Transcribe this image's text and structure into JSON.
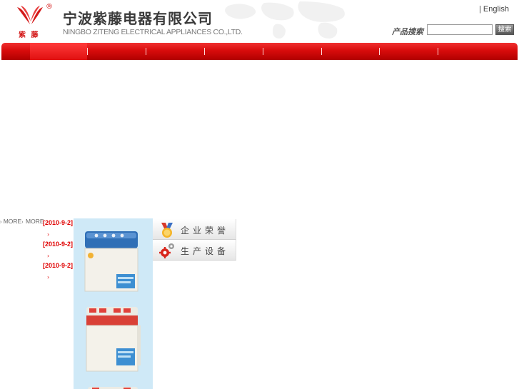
{
  "header": {
    "logo_text": "紫 藤",
    "logo_reg": "®",
    "company_name_cn": "宁波紫藤电器有限公司",
    "company_name_en": "NINGBO ZITENG ELECTRICAL APPLIANCES CO.,LTD.",
    "language_link": "| English",
    "search_label": "产品搜索",
    "search_value": "",
    "search_button": "搜索"
  },
  "nav": {
    "items": [
      "",
      "",
      "",
      "",
      "",
      "",
      "",
      ""
    ],
    "active_index": 0
  },
  "news": {
    "more_labels": [
      "MORE",
      "MORE"
    ],
    "items": [
      {
        "date": "[2010-9-2]",
        "arrow": "›"
      },
      {
        "date": "[2010-9-2]",
        "arrow": "›"
      },
      {
        "date": "[2010-9-2]",
        "arrow": "›"
      }
    ]
  },
  "quick_links": [
    {
      "label": "企业荣誉",
      "icon": "medal-icon"
    },
    {
      "label": "生产设备",
      "icon": "gears-icon"
    }
  ],
  "products": [
    {
      "name": "",
      "icon": "washing-machine-blue-icon"
    },
    {
      "name": "",
      "icon": "washing-machine-red-icon"
    },
    {
      "name": "",
      "icon": "washing-machine-icon"
    }
  ],
  "colors": {
    "brand_red": "#d80c0c",
    "news_red": "#e00000",
    "product_bg": "#cfe9f7"
  }
}
